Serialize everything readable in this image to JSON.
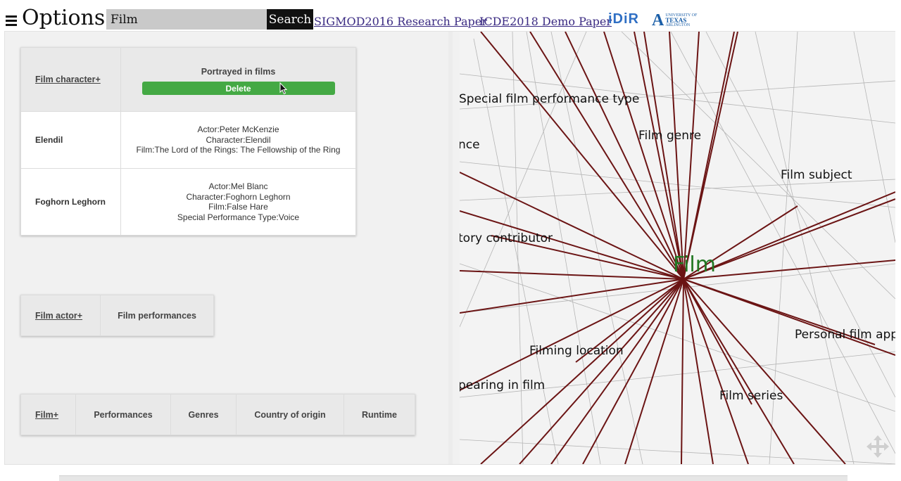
{
  "header": {
    "title": "Options",
    "search_value": "Film",
    "search_button": "Search",
    "links": [
      "SIGMOD2016 Research Paper",
      "ICDE2018 Demo Paper"
    ],
    "idir_logo": "iDiR",
    "uta_logo_letter": "A",
    "uta_logo_top": "UNIVERSITY OF",
    "uta_logo_name": "TEXAS",
    "uta_logo_bottom": "ARLINGTON"
  },
  "table1": {
    "entity_header": "Film character+",
    "column_header": "Portrayed in films",
    "delete_label": "Delete",
    "rows": [
      {
        "name": "Elendil",
        "lines": [
          "Actor:Peter McKenzie",
          "Character:Elendil",
          "Film:The Lord of the Rings: The Fellowship of the Ring"
        ]
      },
      {
        "name": "Foghorn Leghorn",
        "lines": [
          "Actor:Mel Blanc",
          "Character:Foghorn Leghorn",
          "Film:False Hare",
          "Special Performance Type:Voice"
        ]
      }
    ]
  },
  "table2": {
    "entity_header": "Film actor+",
    "columns": [
      "Film performances"
    ]
  },
  "table3": {
    "entity_header": "Film+",
    "columns": [
      "Performances",
      "Genres",
      "Country of origin",
      "Runtime"
    ]
  },
  "graph": {
    "center": "Film",
    "labels": [
      "Special film performance type",
      "Film genre",
      "nce",
      "Film subject",
      "tory contributor",
      "Personal film app",
      "Filming location",
      "pearing in film",
      "Film series"
    ],
    "edge_color": "#6b1414",
    "center_color": "#227722"
  }
}
